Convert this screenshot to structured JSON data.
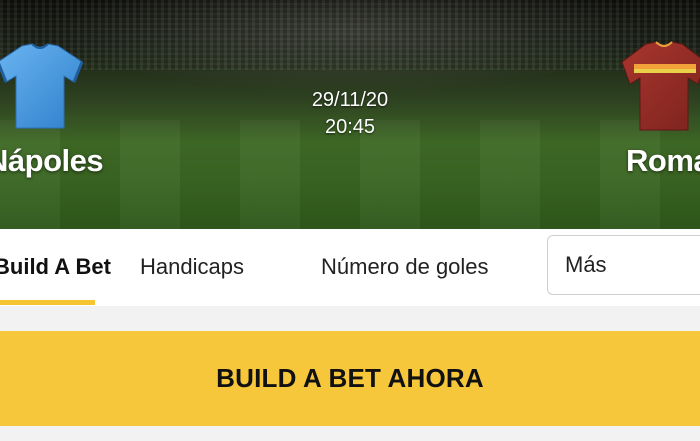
{
  "match": {
    "home_team": "Nápoles",
    "away_team": "Roma",
    "date": "29/11/20",
    "time": "20:45",
    "home_jersey_icon": "blue-jersey-icon",
    "away_jersey_icon": "red-jersey-icon"
  },
  "tabs": [
    {
      "label": "Build A Bet",
      "active": true
    },
    {
      "label": "Handicaps",
      "active": false
    },
    {
      "label": "Número de goles",
      "active": false
    }
  ],
  "more_select": {
    "label": "Más"
  },
  "cta": {
    "label": "BUILD A BET AHORA"
  },
  "colors": {
    "accent": "#f6c73a",
    "home_jersey": "#4a98de",
    "away_jersey": "#8e2a24"
  }
}
